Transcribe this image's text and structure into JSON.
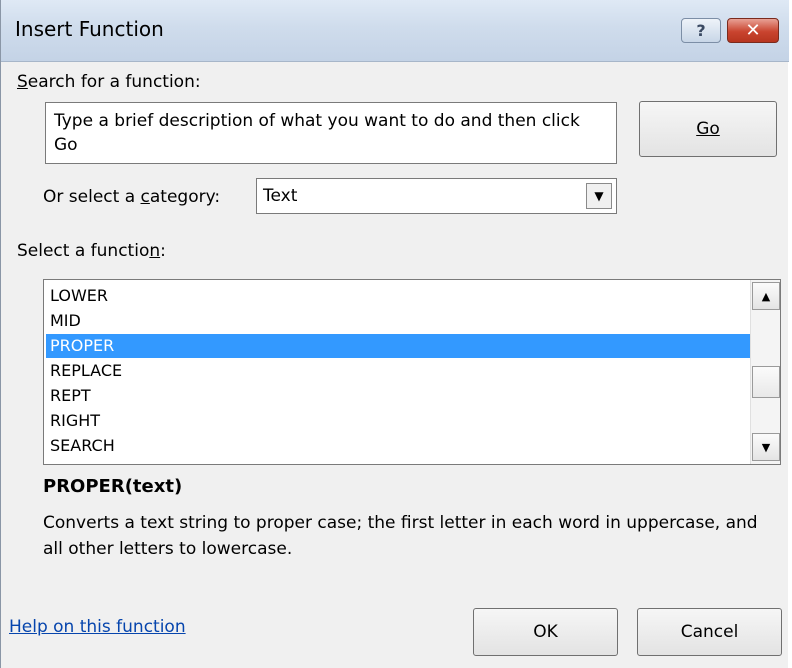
{
  "window": {
    "title": "Insert Function",
    "help_glyph": "?",
    "close_glyph": "✕"
  },
  "search": {
    "label": "Search for a function:",
    "value": "Type a brief description of what you want to do and then click Go",
    "go_label": "Go"
  },
  "category": {
    "label": "Or select a category:",
    "selected": "Text"
  },
  "functions": {
    "label": "Select a function:",
    "items": [
      "LOWER",
      "MID",
      "PROPER",
      "REPLACE",
      "REPT",
      "RIGHT",
      "SEARCH"
    ],
    "selected": "PROPER"
  },
  "details": {
    "signature": "PROPER(text)",
    "description": "Converts a text string to proper case; the first letter in each word in uppercase, and all other letters to lowercase."
  },
  "footer": {
    "help_link": "Help on this function",
    "ok_label": "OK",
    "cancel_label": "Cancel"
  },
  "colors": {
    "selection": "#3399ff",
    "link": "#0645ad",
    "close_button": "#c9442f"
  }
}
